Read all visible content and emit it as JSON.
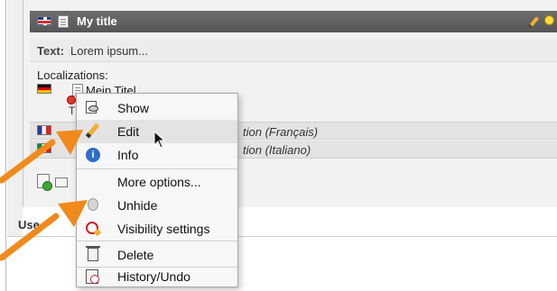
{
  "header": {
    "title": "My title",
    "icons": [
      "uk-flag-icon",
      "page-icon",
      "pencil-icon",
      "lightbulb-icon",
      "page-edge-icon"
    ]
  },
  "record": {
    "text_label": "Text:",
    "text_value": "Lorem ipsum...",
    "localizations_label": "Localizations:",
    "row1_title": "Mein Titel",
    "row1_sub": "T",
    "row2_text": "tion (Français)",
    "row3_text": "tion (Italiano)",
    "user_label": "Use"
  },
  "context_menu": {
    "items": [
      {
        "label": "Show",
        "icon": "eye-icon"
      },
      {
        "label": "Edit",
        "icon": "pencil-icon"
      },
      {
        "label": "Info",
        "icon": "info-icon"
      },
      {
        "label": "More options...",
        "icon": ""
      },
      {
        "label": "Unhide",
        "icon": "lightbulb-icon"
      },
      {
        "label": "Visibility settings",
        "icon": "visibility-icon"
      },
      {
        "label": "Delete",
        "icon": "trash-icon"
      },
      {
        "label": "History/Undo",
        "icon": "history-icon"
      }
    ],
    "hovered": "Edit"
  },
  "colors": {
    "header_bg": "#5f5f5f",
    "menu_bg": "#f7f7f7",
    "hover_bg": "#e3e3e3",
    "arrow": "#f08a1c"
  }
}
